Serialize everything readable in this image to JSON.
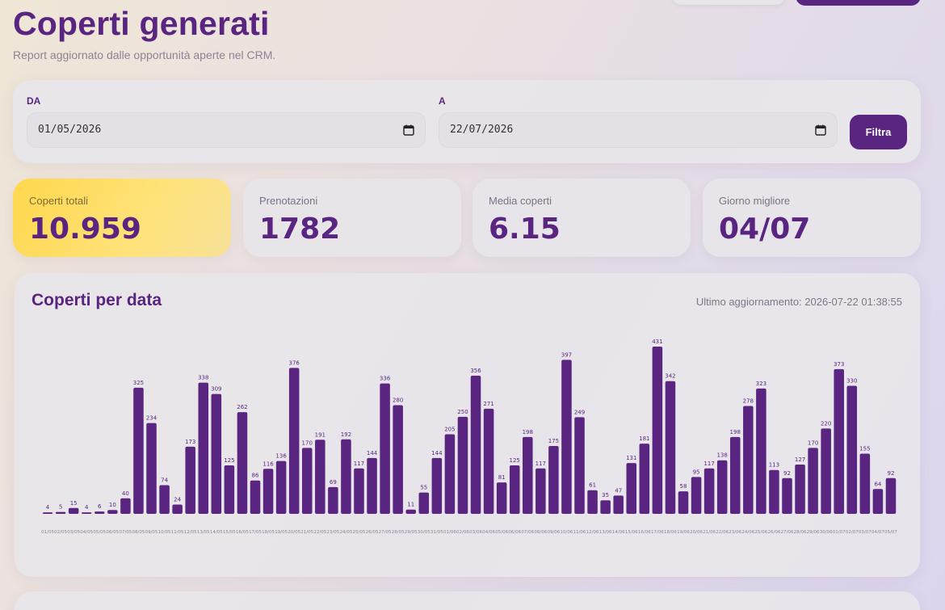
{
  "header": {
    "title": "Coperti generati",
    "subtitle": "Report aggiornato dalle opportunità aperte nel CRM."
  },
  "filters": {
    "from_label": "DA",
    "from_value": "01/05/2026",
    "to_label": "A",
    "to_value": "22/07/2026",
    "submit_label": "Filtra"
  },
  "stats": [
    {
      "label": "Coperti totali",
      "value": "10.959"
    },
    {
      "label": "Prenotazioni",
      "value": "1782"
    },
    {
      "label": "Media coperti",
      "value": "6.15"
    },
    {
      "label": "Giorno migliore",
      "value": "04/07"
    }
  ],
  "chart_panel": {
    "title": "Coperti per data",
    "updated": "Ultimo aggiornamento: 2026-07-22 01:38:55"
  },
  "colors": {
    "accent": "#5a2580",
    "highlight": "#ffd84d"
  },
  "chart_data": {
    "type": "bar",
    "title": "Coperti per data",
    "xlabel": "",
    "ylabel": "",
    "grid": false,
    "legend": "none",
    "categories": [
      "01/05",
      "02/05",
      "03/05",
      "04/05",
      "05/05",
      "06/05",
      "07/05",
      "08/05",
      "09/05",
      "10/05",
      "11/05",
      "12/05",
      "13/05",
      "14/05",
      "15/05",
      "16/05",
      "17/05",
      "18/05",
      "19/05",
      "20/05",
      "21/05",
      "22/05",
      "23/05",
      "24/05",
      "25/05",
      "26/05",
      "27/05",
      "28/05",
      "29/05",
      "30/05",
      "31/05",
      "01/06",
      "02/06",
      "03/06",
      "04/06",
      "05/06",
      "06/06",
      "07/06",
      "08/06",
      "09/06",
      "10/06",
      "11/06",
      "12/06",
      "13/06",
      "14/06",
      "15/06",
      "16/06",
      "17/06",
      "18/06",
      "19/06",
      "20/06",
      "21/06",
      "22/06",
      "23/06",
      "24/06",
      "25/06",
      "26/06",
      "27/06",
      "28/06",
      "29/06",
      "30/06",
      "01/07",
      "02/07",
      "03/07",
      "04/07",
      "05/07",
      "06/07",
      "07/07",
      "08/07",
      "09/07",
      "10/07",
      "11/07",
      "12/07",
      "13/07",
      "14/07",
      "15/07",
      "16/07",
      "17/07",
      "18/07",
      "19/07",
      "20/07",
      "21/07",
      "22/07"
    ],
    "values": [
      4,
      5,
      15,
      4,
      6,
      10,
      40,
      325,
      234,
      74,
      24,
      173,
      338,
      309,
      125,
      262,
      86,
      116,
      136,
      376,
      170,
      191,
      69,
      192,
      117,
      144,
      336,
      280,
      11,
      55,
      144,
      205,
      250,
      356,
      271,
      81,
      125,
      198,
      117,
      175,
      397,
      249,
      61,
      35,
      47,
      131,
      181,
      431,
      342,
      58,
      95,
      117,
      138,
      198,
      278,
      323,
      113,
      92,
      127,
      170,
      220,
      373,
      330,
      155,
      64,
      92
    ]
  }
}
